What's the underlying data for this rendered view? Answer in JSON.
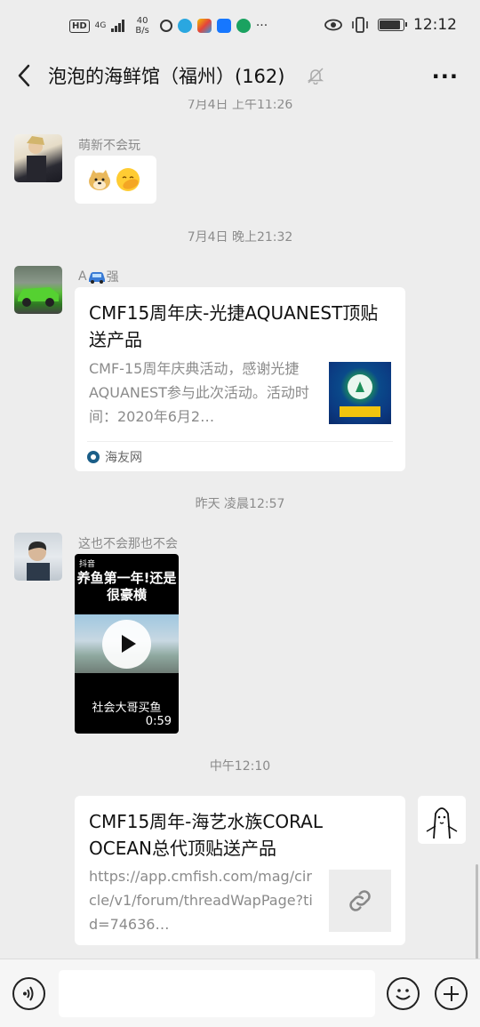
{
  "status_bar": {
    "hd": "HD",
    "network": "4G",
    "speed_value": "40",
    "speed_unit": "B/s",
    "more_dots": "···",
    "time": "12:12"
  },
  "header": {
    "title": "泡泡的海鲜馆（福州）(162)",
    "more": "···"
  },
  "messages": {
    "partial_time": "7月4日 上午11:26",
    "msg1": {
      "sender": "萌新不会玩"
    },
    "time2": "7月4日 晚上21:32",
    "msg2": {
      "sender_prefix": "A",
      "sender_suffix": "强",
      "title": "CMF15周年庆-光捷AQUANEST顶贴送产品",
      "desc": "CMF-15周年庆典活动，感谢光捷AQUANEST参与此次活动。活动时间：2020年6月2…",
      "source": "海友网"
    },
    "time3": "昨天 凌晨12:57",
    "msg3": {
      "sender": "这也不会那也不会",
      "video_top": "养鱼第一年!还是很豪横",
      "video_bottom": "社会大哥买鱼",
      "duration": "0:59",
      "platform": "抖音"
    },
    "time4": "中午12:10",
    "msg4": {
      "title": "CMF15周年-海艺水族CORAL OCEAN总代顶贴送产品",
      "url": "https://app.cmfish.com/mag/circle/v1/forum/threadWapPage?tid=74636…"
    }
  },
  "colors": {
    "background": "#ededed",
    "bubble": "#ffffff",
    "meta_text": "#8b8b8b"
  }
}
